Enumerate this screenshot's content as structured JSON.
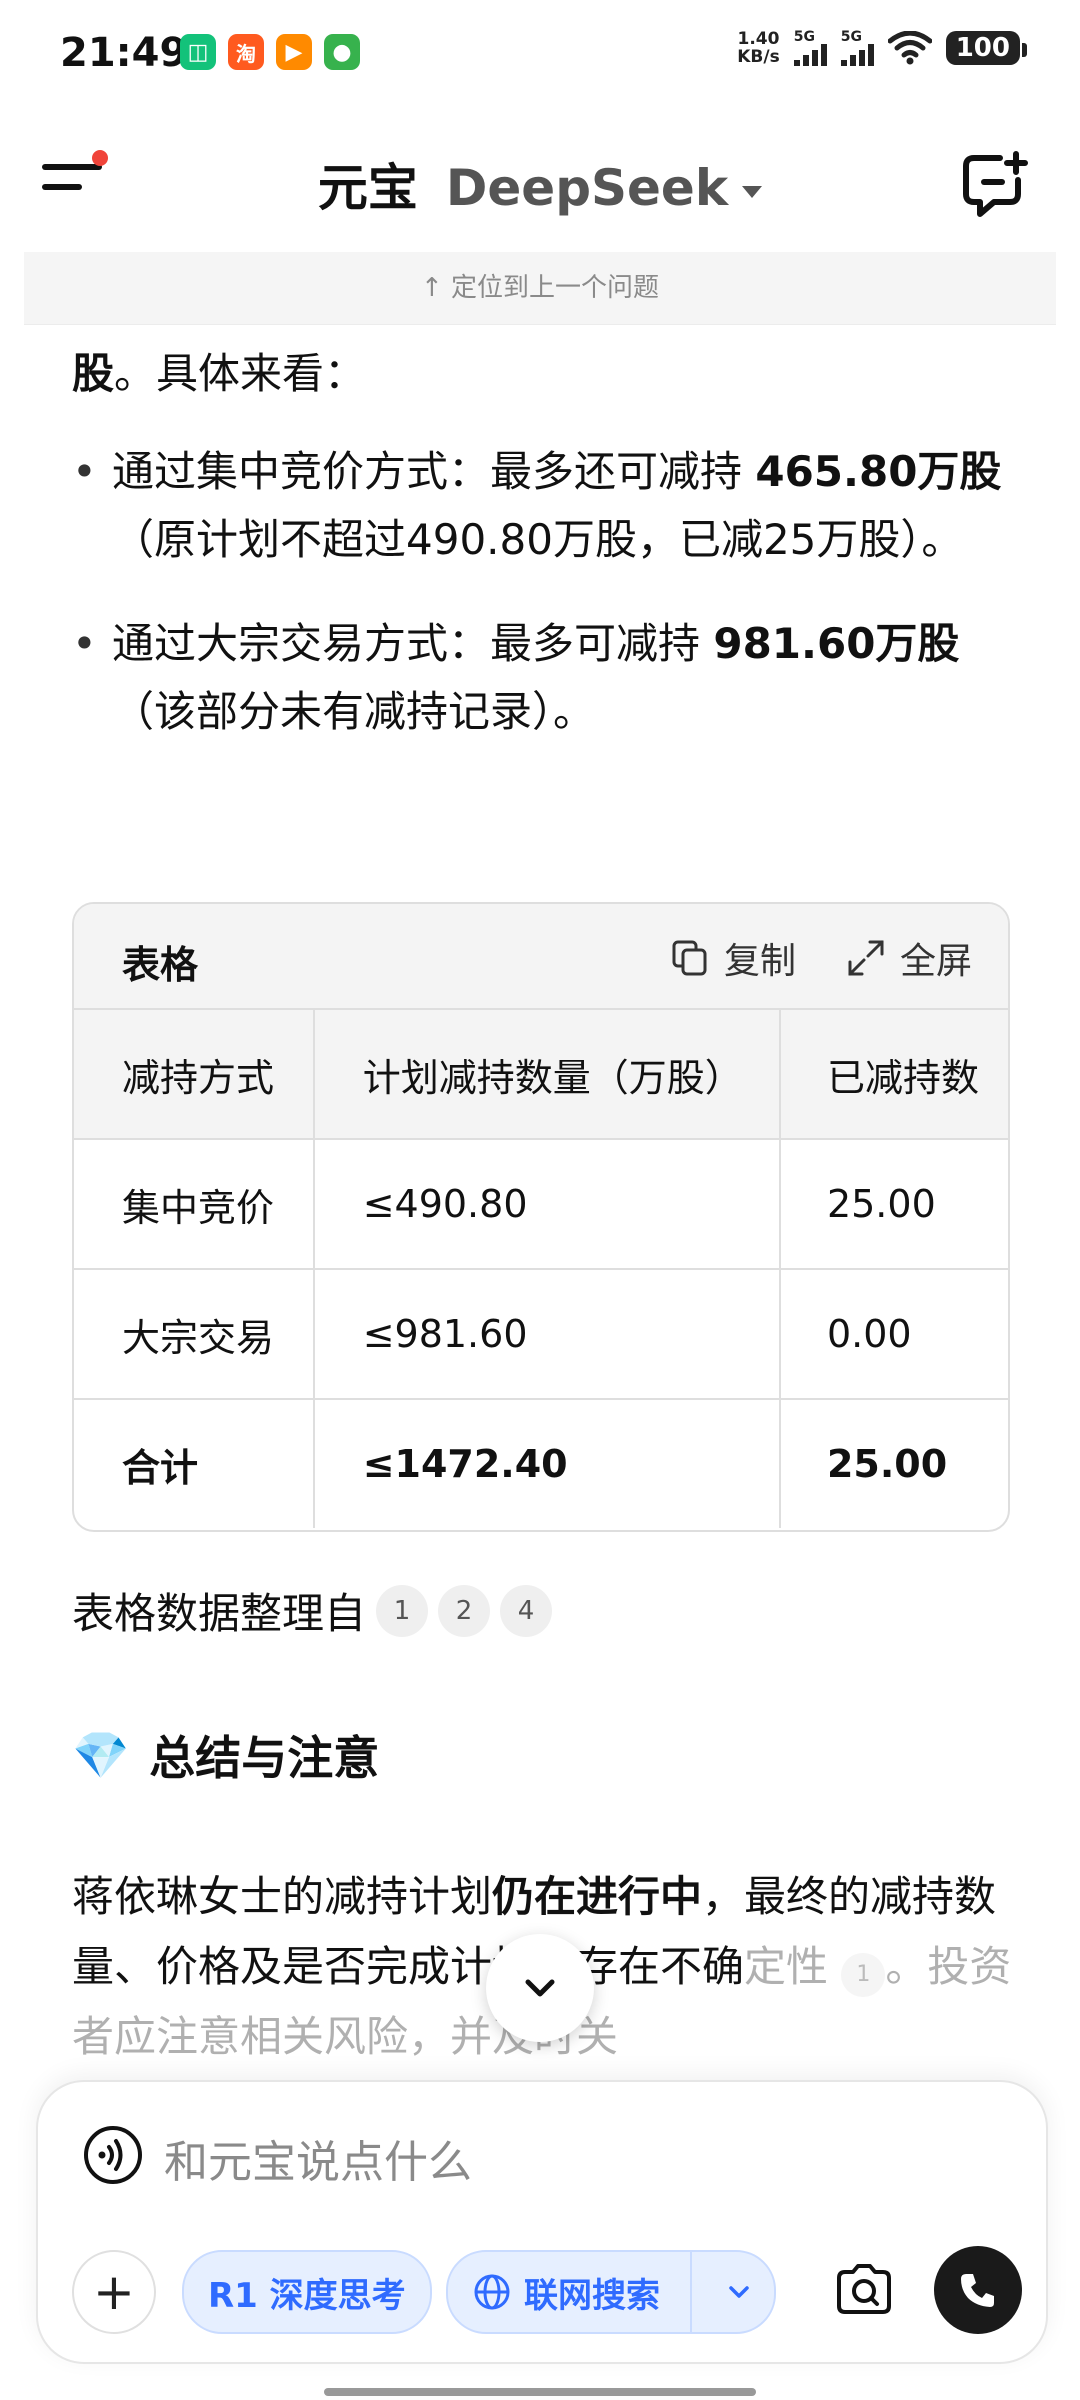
{
  "status_bar": {
    "time": "21:49",
    "speed_value": "1.40",
    "speed_unit": "KB/s",
    "sim1": "5G",
    "sim2": "5G",
    "battery": "100",
    "app_icons": [
      {
        "name": "app-icon-green",
        "glyph": "◫",
        "color": "#13c27a"
      },
      {
        "name": "taobao-icon",
        "glyph": "淘",
        "color": "#ff5a1f"
      },
      {
        "name": "video-icon",
        "glyph": "▶",
        "color": "#ff8a00"
      },
      {
        "name": "game-icon",
        "glyph": "●",
        "color": "#37b24d"
      }
    ]
  },
  "header": {
    "title": "元宝",
    "model": "DeepSeek"
  },
  "locate_bar": {
    "label": "↑ 定位到上一个问题"
  },
  "content": {
    "intro_bold": "股",
    "intro_rest": "。具体来看：",
    "bullets": [
      {
        "prefix": "通过集中竞价方式：最多还可减持 ",
        "bold": "465.80万股",
        "suffix": "（原计划不超过490.80万股，已减25万股）。"
      },
      {
        "prefix": "通过大宗交易方式：最多可减持 ",
        "bold": "981.60万股",
        "suffix": "（该部分未有减持记录）。"
      }
    ]
  },
  "table_card": {
    "title": "表格",
    "copy_label": "复制",
    "fullscreen_label": "全屏",
    "headers": [
      "减持方式",
      "计划减持数量（万股）",
      "已减持数"
    ],
    "rows": [
      [
        "集中竞价",
        "≤490.80",
        "25.00"
      ],
      [
        "大宗交易",
        "≤981.60",
        "0.00"
      ],
      [
        "合计",
        "≤1472.40",
        "25.00"
      ]
    ]
  },
  "source": {
    "label": "表格数据整理自",
    "refs": [
      "1",
      "2",
      "4"
    ]
  },
  "summary": {
    "emoji": "💎",
    "title": "总结与注意",
    "text_1": "蒋依琳女士的减持计划",
    "text_bold": "仍在进行中",
    "text_2": "，最终的减持数量、价格及是否完成计划均存在不确",
    "text_faded": "定性",
    "ref": "1",
    "text_faded_2": "。投资者应注意相关风险，并及时关"
  },
  "input": {
    "placeholder": "和元宝说点什么",
    "deep_think_label": "R1 深度思考",
    "web_search_label": "联网搜索"
  }
}
